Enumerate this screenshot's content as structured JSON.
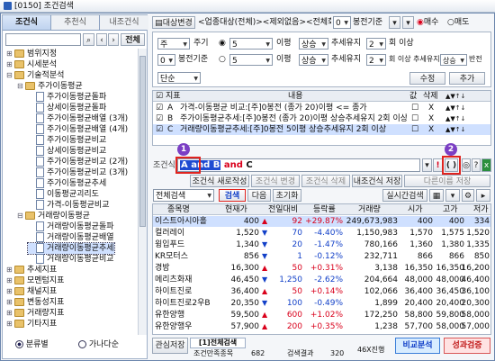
{
  "window": {
    "title": "[0150] 조건검색"
  },
  "left": {
    "tabs": [
      "조건식",
      "추천식",
      "내조건식"
    ],
    "search_btn": "전체",
    "radio_cat": "분류별",
    "radio_alpha": "가나다순",
    "tree": [
      {
        "label": "범위지정",
        "level": 0,
        "type": "folder"
      },
      {
        "label": "시세분석",
        "level": 0,
        "type": "folder"
      },
      {
        "label": "기술적분석",
        "level": 0,
        "type": "folder"
      },
      {
        "label": "주가이동평균",
        "level": 1,
        "type": "folder"
      },
      {
        "label": "주가이동평균돌파",
        "level": 2,
        "type": "doc"
      },
      {
        "label": "상세이동평균돌파",
        "level": 2,
        "type": "doc"
      },
      {
        "label": "주가이동평균배열 (3개)",
        "level": 2,
        "type": "doc"
      },
      {
        "label": "주가이동평균배열 (4개)",
        "level": 2,
        "type": "doc"
      },
      {
        "label": "주가이동평균비교",
        "level": 2,
        "type": "doc"
      },
      {
        "label": "상세이동평균비교",
        "level": 2,
        "type": "doc"
      },
      {
        "label": "주가이동평균비교 (2개)",
        "level": 2,
        "type": "doc"
      },
      {
        "label": "주가이동평균비교 (3개)",
        "level": 2,
        "type": "doc"
      },
      {
        "label": "주가이동평균추세",
        "level": 2,
        "type": "doc"
      },
      {
        "label": "이동평균괴리도",
        "level": 2,
        "type": "doc"
      },
      {
        "label": "가격-이동평균비교",
        "level": 2,
        "type": "doc"
      },
      {
        "label": "거래량이동평균",
        "level": 1,
        "type": "folder"
      },
      {
        "label": "거래량이동평균돌파",
        "level": 2,
        "type": "doc"
      },
      {
        "label": "거래량이동평균배열",
        "level": 2,
        "type": "doc"
      },
      {
        "label": "거래량이동평균추세",
        "level": 2,
        "type": "doc",
        "selected": true
      },
      {
        "label": "거래량이동평균비교",
        "level": 2,
        "type": "doc"
      },
      {
        "label": "추세지표",
        "level": 0,
        "type": "folder"
      },
      {
        "label": "모멘텀지표",
        "level": 0,
        "type": "folder"
      },
      {
        "label": "채널지표",
        "level": 0,
        "type": "folder"
      },
      {
        "label": "변동성지표",
        "level": 0,
        "type": "folder"
      },
      {
        "label": "거래량지표",
        "level": 0,
        "type": "folder"
      },
      {
        "label": "기타지표",
        "level": 0,
        "type": "folder"
      }
    ]
  },
  "top": {
    "target_btn": "대상변경",
    "target_text": "<업종대상(전체)><제외없음><전체회결산>",
    "num": "0",
    "period_label": "봉전기준",
    "buy": "매수",
    "sell": "매도"
  },
  "params": {
    "p1_sel": "주",
    "p1_label": "주기",
    "p1_num": "5",
    "p1_label2": "이평",
    "p1_dir": "상승",
    "p1_trend": "추세유지",
    "p1_cnt": "2",
    "p1_tail": "회 이상",
    "p2_num": "0",
    "p2_label": "봉전기준",
    "p2_num2": "5",
    "p2_label2": "이평",
    "p2_dir": "상승",
    "p2_trend": "추세유지",
    "p2_cnt": "2",
    "p2_trail": "회 이상 추세유지 후",
    "p2_dir2": "상승",
    "p2_tail": "반전",
    "mode": "단순",
    "edit_btn": "수정",
    "add_btn": "추가"
  },
  "cond": {
    "headers": [
      "지표",
      "내용",
      "값",
      "삭제"
    ],
    "rows": [
      {
        "key": "A",
        "text": "가격-이동평균 비교:[주]0봉전 (종가 20)이평 <= 종가"
      },
      {
        "key": "B",
        "text": "주가이동평균추세:[주]0봉전 (종가 20)이평 상승추세유지 2회 이상"
      },
      {
        "key": "C",
        "text": "거래량이동평균추세:[주]0봉전 5이평 상승추세유지 2회 이상"
      }
    ],
    "del": "X"
  },
  "formula": {
    "label": "조건식",
    "expr_sel": "A and B",
    "and_word": "and",
    "c_word": "C",
    "badge1": "1",
    "badge2": "2",
    "paren": "( )"
  },
  "actions": {
    "new": "조건식 새로작성",
    "modify": "조건식 변경",
    "delete": "조건식 삭제",
    "save": "내조건식 저장",
    "save_as": "다른이름 저장"
  },
  "search": {
    "select": "전체검색",
    "search": "검색",
    "next": "다음",
    "reset": "초기화",
    "realtime": "실시간검색"
  },
  "results": {
    "headers": [
      "종목명",
      "현재가",
      "전일대비",
      "등락률",
      "거래량",
      "시가",
      "고가",
      "저가"
    ],
    "rows": [
      {
        "name": "이스트아시아홀",
        "price": "400",
        "sign": "▲",
        "chg": "92",
        "rate": "+29.87%",
        "vol": "249,673,983",
        "open": "400",
        "high": "400",
        "low": "334",
        "dir": "up",
        "selected": true
      },
      {
        "name": "컬러레이",
        "price": "1,520",
        "sign": "▼",
        "chg": "70",
        "rate": "-4.40%",
        "vol": "1,150,983",
        "open": "1,570",
        "high": "1,575",
        "low": "1,520",
        "dir": "dn"
      },
      {
        "name": "윙입푸드",
        "price": "1,340",
        "sign": "▼",
        "chg": "20",
        "rate": "-1.47%",
        "vol": "780,166",
        "open": "1,360",
        "high": "1,380",
        "low": "1,335",
        "dir": "dn"
      },
      {
        "name": "KR모터스",
        "price": "856",
        "sign": "▼",
        "chg": "1",
        "rate": "-0.12%",
        "vol": "232,711",
        "open": "866",
        "high": "866",
        "low": "850",
        "dir": "dn"
      },
      {
        "name": "경방",
        "price": "16,300",
        "sign": "▲",
        "chg": "50",
        "rate": "+0.31%",
        "vol": "3,138",
        "open": "16,350",
        "high": "16,350",
        "low": "16,200",
        "dir": "up"
      },
      {
        "name": "메리츠화재",
        "price": "46,450",
        "sign": "▼",
        "chg": "1,250",
        "rate": "-2.62%",
        "vol": "204,664",
        "open": "48,000",
        "high": "48,000",
        "low": "46,400",
        "dir": "dn"
      },
      {
        "name": "하이트진로",
        "price": "36,400",
        "sign": "▲",
        "chg": "50",
        "rate": "+0.14%",
        "vol": "102,066",
        "open": "36,400",
        "high": "36,450",
        "low": "36,100",
        "dir": "up"
      },
      {
        "name": "하이트진로2우B",
        "price": "20,350",
        "sign": "▼",
        "chg": "100",
        "rate": "-0.49%",
        "vol": "1,899",
        "open": "20,400",
        "high": "20,400",
        "low": "20,300",
        "dir": "dn"
      },
      {
        "name": "유한양행",
        "price": "59,500",
        "sign": "▲",
        "chg": "600",
        "rate": "+1.02%",
        "vol": "172,250",
        "open": "58,800",
        "high": "59,800",
        "low": "58,000",
        "dir": "up"
      },
      {
        "name": "유한양행우",
        "price": "57,900",
        "sign": "▲",
        "chg": "200",
        "rate": "+0.35%",
        "vol": "1,238",
        "open": "57,700",
        "high": "58,000",
        "low": "57,000",
        "dir": "up"
      }
    ]
  },
  "bottom": {
    "save": "관심저장",
    "tab": "[1]전체검색",
    "count_label": "조건만족종목",
    "count": "682",
    "result_label": "검색결과",
    "result": "320",
    "speed": "46X진행",
    "compare": "비교분석",
    "verify": "성과검증"
  },
  "colors": {
    "border": "#6b86ad",
    "selected_row": "#cfe0ff",
    "accent_red": "#e0241f",
    "badge": "#7b3fc4"
  }
}
